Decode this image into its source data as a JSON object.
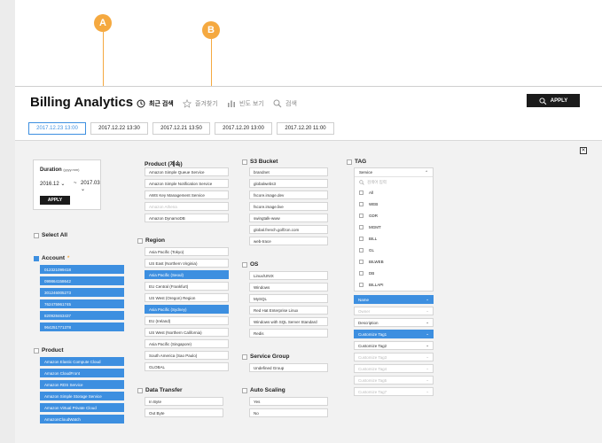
{
  "callouts": {
    "a": "A",
    "b": "B"
  },
  "title": "Billing Analytics",
  "nav": [
    {
      "label": "최근 검색",
      "icon": "clock-icon"
    },
    {
      "label": "즐겨찾기",
      "icon": "star-icon"
    },
    {
      "label": "빈도 보기",
      "icon": "bar-chart-icon"
    },
    {
      "label": "검색",
      "icon": "search-icon"
    }
  ],
  "apply_top": "APPLY",
  "date_tabs": [
    "2017.12.23 13:00",
    "2017.12.22 13:30",
    "2017.12.21 13:50",
    "2017.12.20 13:00",
    "2017.12.20 11:00"
  ],
  "close": "✕",
  "duration": {
    "title": "Duration",
    "hint": "(yyyy.mm)",
    "from": "2016.12",
    "sep": "~",
    "to": "2017.03",
    "apply": "APPLY"
  },
  "select_all": "Select All",
  "account": {
    "title": "Account",
    "items": [
      "012321099418",
      "099864158642",
      "301246005273",
      "762475961745",
      "820928463437",
      "964251771378"
    ]
  },
  "product": {
    "title": "Product",
    "items": [
      "Amazon Elastic Compute Cloud",
      "Amazon CloudFront",
      "Amazon RDS Service",
      "Amazon Simple Storage Service",
      "Amazon Virtual Private Cloud",
      "AmazonCloudWatch"
    ]
  },
  "product_cont": {
    "title": "Product (계속)",
    "items": [
      "Amazon Simple Queue Service",
      "Amazon Simple Notification Service",
      "AWS Key Management Service",
      "Amazon Athena",
      "Amazon DynamoDB"
    ]
  },
  "region": {
    "title": "Region",
    "items": [
      "Asia Pacific (Tokyo)",
      "US East (Northern Virginia)",
      "Asia Pacific (Seoul)",
      "EU Central (Frankfurt)",
      "US West (Oregon) Region",
      "Asia Pacific (Sydney)",
      "EU (Ireland)",
      "US West (Northern California)",
      "Asia Pacific (Singapore)",
      "South America (Sao Paulo)",
      "GLOBAL"
    ]
  },
  "data_transfer": {
    "title": "Data Transfer",
    "items": [
      "In Byte",
      "Out Byte"
    ]
  },
  "s3": {
    "title": "S3 Bucket",
    "items": [
      "brandnet",
      "globalwebs3",
      "fscore.image.dev",
      "fscore.image.live",
      "swingtalk-www",
      "global.french.golfzon.com",
      "web-trace"
    ]
  },
  "os": {
    "title": "OS",
    "items": [
      "Linux/UNIX",
      "Windows",
      "MySQL",
      "Red Hat Enterprise Linux",
      "Windows with SQL Server Standard",
      "Redis"
    ]
  },
  "service_group": {
    "title": "Service Group",
    "items": [
      "Undefined Group"
    ]
  },
  "auto_scaling": {
    "title": "Auto Scaling",
    "items": [
      "Yes",
      "No"
    ]
  },
  "tag": {
    "title": "TAG",
    "header": "Service",
    "search_placeholder": "검색어 입력",
    "options": [
      "All",
      "WEB",
      "GDR",
      "MGMT",
      "BILL",
      "GL",
      "BILWEB",
      "DB",
      "BILLAPI"
    ],
    "dropdowns": [
      "Name",
      "Owner",
      "Description",
      "Customize Tag1",
      "Customize Tag2",
      "Customize Tag3",
      "Customize Tag4",
      "Customize Tag5",
      "Customize Tag7"
    ]
  }
}
